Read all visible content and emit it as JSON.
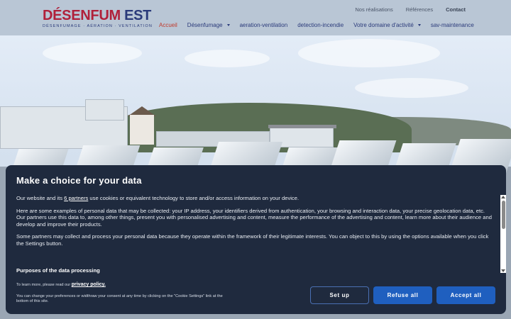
{
  "logo": {
    "main": "DÉSENFUM",
    "main_est": " EST",
    "tagline": "DÉSENFUMAGE · AÉRATION · VENTILATION"
  },
  "top_links": [
    "Nos réalisations",
    "Références",
    "Contact"
  ],
  "nav": {
    "items": [
      {
        "label": "Accueil",
        "active": true
      },
      {
        "label": "Désenfumage",
        "dropdown": true
      },
      {
        "label": "aeration-ventilation"
      },
      {
        "label": "detection-incendie"
      },
      {
        "label": "Votre domaine d'activité",
        "dropdown": true
      },
      {
        "label": "sav-maintenance"
      }
    ]
  },
  "consent": {
    "title": "Make a choice for your data",
    "p1_prefix": "Our website and its ",
    "p1_link": "6 partners",
    "p1_suffix": " use cookies or equivalent technology to store and/or access information on your device.",
    "p2": "Here are some examples of personal data that may be collected: your IP address, your identifiers derived from authentication, your browsing and interaction data, your precise geolocation data, etc.",
    "p3": "Our partners use this data to, among other things, present you with personalised advertising and content, measure the performance of the advertising and content, learn more about their audience and develop and improve their products.",
    "p4": "Some partners may collect and process your personal data because they operate within the framework of their legitimate interests. You can object to this by using the options available when you click the Settings button.",
    "purposes_heading": "Purposes of the data processing",
    "learn_more_prefix": "To learn more, please read our ",
    "privacy_link": "privacy policy.",
    "change_prefs": "You can change your preferences or widthraw your consent at any time by clicking on the \"Cookie Settings\" link at the bottom of this site.",
    "buttons": {
      "setup": "Set up",
      "refuse": "Refuse all",
      "accept": "Accept all"
    }
  },
  "colors": {
    "brand_red": "#b0203a",
    "brand_navy": "#2a3a7a",
    "consent_bg": "#1f2a3e",
    "button_blue": "#1f5fbf"
  }
}
